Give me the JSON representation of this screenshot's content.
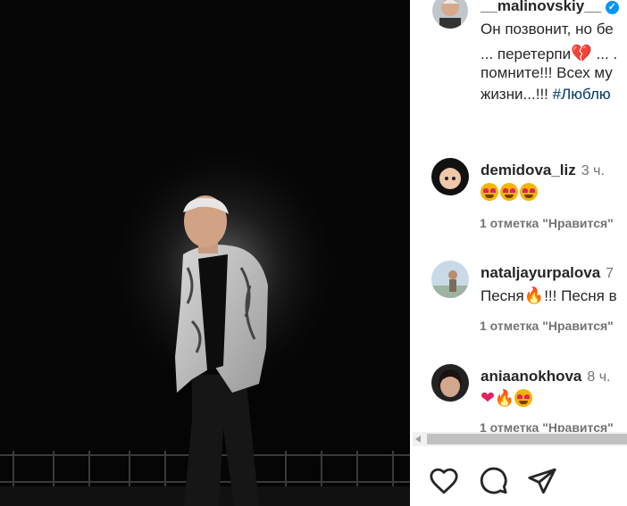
{
  "post": {
    "author": "__malinovskiy__",
    "caption_lines": [
      "Он позвонит, но бе",
      "... перетерпи",
      "помните!!! Всех му",
      "жизни...!!!"
    ],
    "caption_hashtag": "#Люблю",
    "verified_icon": "verified-badge-icon"
  },
  "comments": [
    {
      "username": "demidova_liz",
      "time": "3 ч.",
      "likes": "1 отметка \"Нравится\""
    },
    {
      "username": "nataljayurpalova",
      "time": "7",
      "text": "Песня",
      "text_after": "!!! Песня в",
      "likes": "1 отметка \"Нравится\""
    },
    {
      "username": "aniaanokhova",
      "time": "8 ч.",
      "likes": "1 отметка \"Нравится\""
    }
  ],
  "icons": {
    "like": "heart-outline-icon",
    "comment": "comment-bubble-icon",
    "share": "paper-plane-icon"
  },
  "colors": {
    "link": "#00376b",
    "muted": "#737373",
    "verified": "#0095f6"
  }
}
